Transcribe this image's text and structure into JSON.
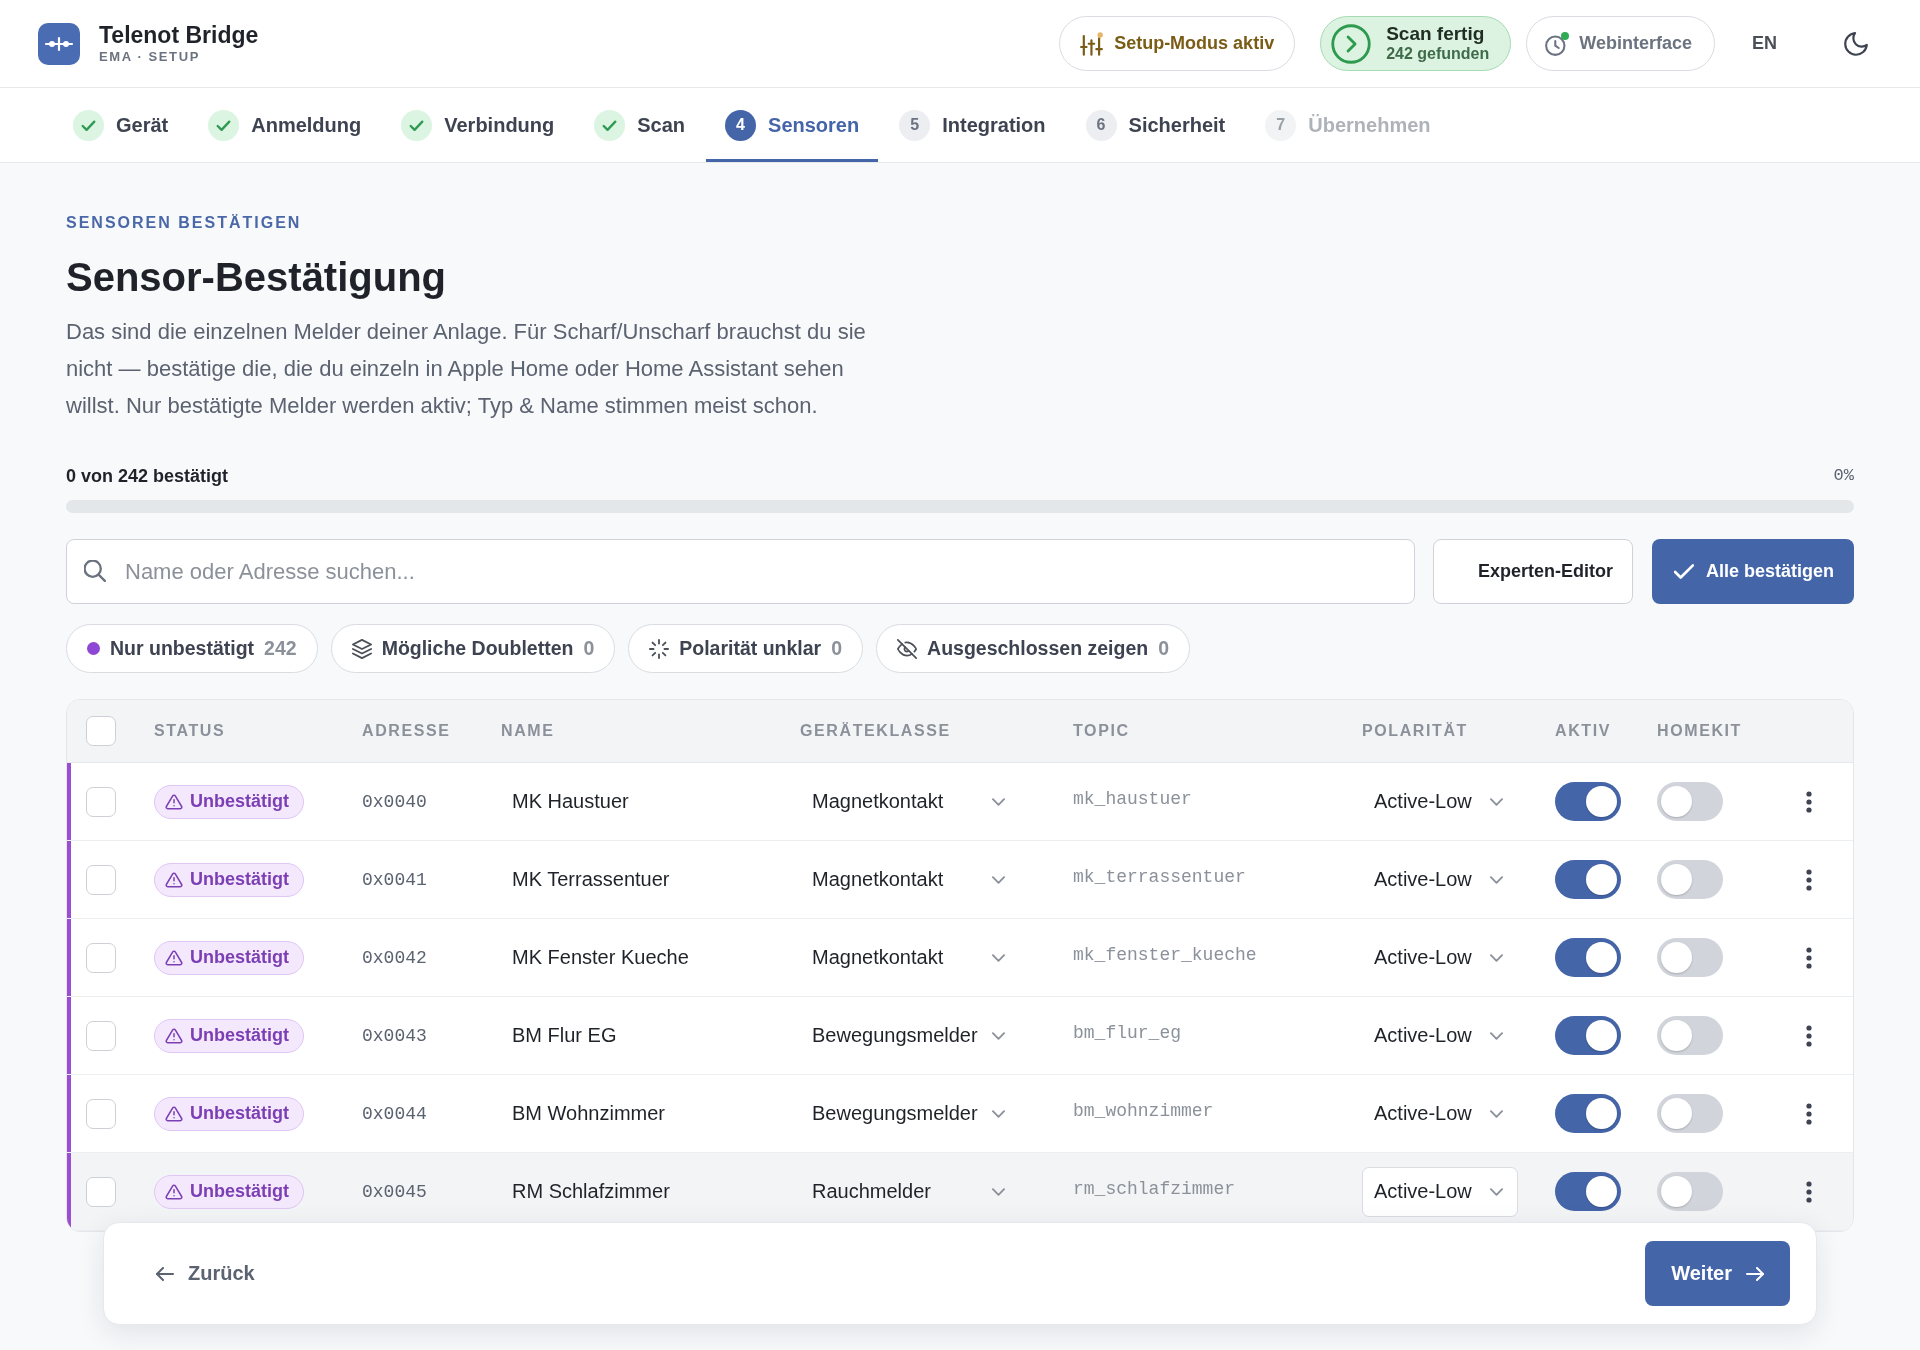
{
  "app": {
    "title": "Telenot Bridge",
    "subtitle": "EMA · SETUP"
  },
  "header_actions": {
    "setup_mode": {
      "label": "Setup-Modus aktiv"
    },
    "scan": {
      "title": "Scan fertig",
      "detail": "242 gefunden"
    },
    "webinterface": {
      "label": "Webinterface",
      "online": true
    },
    "language": "EN"
  },
  "steps": [
    {
      "label": "Gerät",
      "done": true,
      "selected": false,
      "disabled": false
    },
    {
      "label": "Anmeldung",
      "done": true,
      "selected": false,
      "disabled": false
    },
    {
      "label": "Verbindung",
      "done": true,
      "selected": false,
      "disabled": false
    },
    {
      "label": "Scan",
      "done": true,
      "selected": false,
      "disabled": false
    },
    {
      "label": "Sensoren",
      "number": "4",
      "done": false,
      "selected": true,
      "disabled": false
    },
    {
      "label": "Integration",
      "number": "5",
      "done": false,
      "selected": false,
      "disabled": false
    },
    {
      "label": "Sicherheit",
      "number": "6",
      "done": false,
      "selected": false,
      "disabled": false
    },
    {
      "label": "Übernehmen",
      "number": "7",
      "done": false,
      "selected": false,
      "disabled": true
    }
  ],
  "page": {
    "eyebrow": "SENSOREN BESTÄTIGEN",
    "title": "Sensor-Bestätigung",
    "description": "Das sind die einzelnen Melder deiner Anlage. Für Scharf/Unscharf brauchst du sie nicht — bestätige die, die du einzeln in Apple Home oder Home Assistant sehen willst. Nur bestätigte Melder werden aktiv; Typ & Name stimmen meist schon."
  },
  "progress": {
    "label": "0 von 242 bestätigt",
    "percent": "0%"
  },
  "search": {
    "placeholder": "Name oder Adresse suchen..."
  },
  "buttons": {
    "expert": "Experten-Editor",
    "confirm_all": "Alle bestätigen"
  },
  "filters": [
    {
      "kind": "unconfirmed",
      "label": "Nur unbestätigt",
      "count": "242"
    },
    {
      "kind": "duplicates",
      "label": "Mögliche Doubletten",
      "count": "0"
    },
    {
      "kind": "polarity",
      "label": "Polarität unklar",
      "count": "0"
    },
    {
      "kind": "excluded",
      "label": "Ausgeschlossen zeigen",
      "count": "0"
    }
  ],
  "table": {
    "all_checked": false,
    "columns": [
      "STATUS",
      "ADRESSE",
      "NAME",
      "GERÄTEKLASSE",
      "TOPIC",
      "POLARITÄT",
      "AKTIV",
      "HOMEKIT"
    ],
    "rows": [
      {
        "checked": false,
        "status": {
          "kind": "unconfirmed",
          "label": "Unbestätigt"
        },
        "address": "0x0040",
        "name": "MK Haustuer",
        "device_class": "Magnetkontakt",
        "topic": "mk_haustuer",
        "polarity": "Active-Low",
        "active": true,
        "homekit": false,
        "highlighted": false
      },
      {
        "checked": false,
        "status": {
          "kind": "unconfirmed",
          "label": "Unbestätigt"
        },
        "address": "0x0041",
        "name": "MK Terrassentuer",
        "device_class": "Magnetkontakt",
        "topic": "mk_terrassentuer",
        "polarity": "Active-Low",
        "active": true,
        "homekit": false,
        "highlighted": false
      },
      {
        "checked": false,
        "status": {
          "kind": "unconfirmed",
          "label": "Unbestätigt"
        },
        "address": "0x0042",
        "name": "MK Fenster Kueche",
        "device_class": "Magnetkontakt",
        "topic": "mk_fenster_kueche",
        "polarity": "Active-Low",
        "active": true,
        "homekit": false,
        "highlighted": false
      },
      {
        "checked": false,
        "status": {
          "kind": "unconfirmed",
          "label": "Unbestätigt"
        },
        "address": "0x0043",
        "name": "BM Flur EG",
        "device_class": "Bewegungsmelder",
        "topic": "bm_flur_eg",
        "polarity": "Active-Low",
        "active": true,
        "homekit": false,
        "highlighted": false
      },
      {
        "checked": false,
        "status": {
          "kind": "unconfirmed",
          "label": "Unbestätigt"
        },
        "address": "0x0044",
        "name": "BM Wohnzimmer",
        "device_class": "Bewegungsmelder",
        "topic": "bm_wohnzimmer",
        "polarity": "Active-Low",
        "active": true,
        "homekit": false,
        "highlighted": false
      },
      {
        "checked": false,
        "status": {
          "kind": "unconfirmed",
          "label": "Unbestätigt"
        },
        "address": "0x0045",
        "name": "RM Schlafzimmer",
        "device_class": "Rauchmelder",
        "topic": "rm_schlafzimmer",
        "polarity": "Active-Low",
        "active": true,
        "homekit": false,
        "highlighted": true
      }
    ]
  },
  "footer": {
    "back": "Zurück",
    "next": "Weiter"
  }
}
